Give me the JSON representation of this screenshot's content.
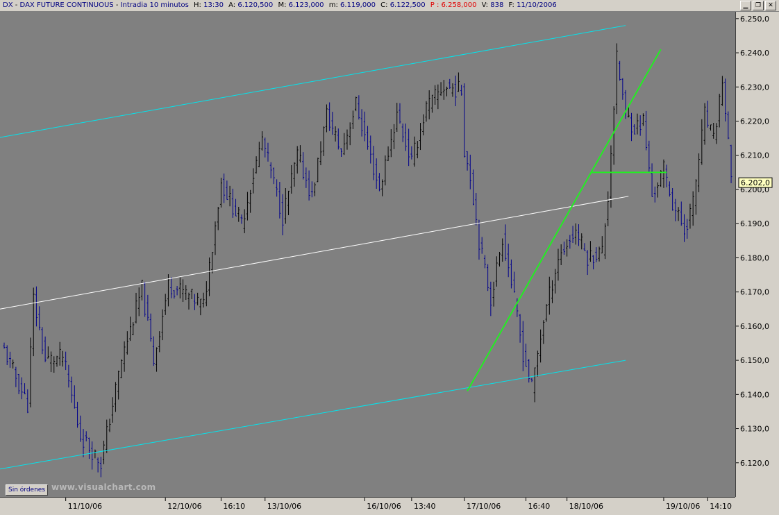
{
  "header": {
    "symbol": "DX",
    "instrument": "DAX FUTURE CONTINUOUS",
    "timeframe": "Intradia 10 minutos",
    "hour_label": "H:",
    "hour": "13:30",
    "open_label": "A:",
    "open": "6.120,500",
    "high_label": "M:",
    "high": "6.123,000",
    "low_label": "m:",
    "low": "6.119,000",
    "close_label": "C:",
    "close": "6.122,500",
    "price_label": "P :",
    "price": "6.258,000",
    "volume_label": "V:",
    "volume": "838",
    "date_label": "F:",
    "date": "11/10/2006"
  },
  "window_buttons": [
    {
      "name": "minimize",
      "glyph": "▁"
    },
    {
      "name": "restore",
      "glyph": "❐"
    },
    {
      "name": "close",
      "glyph": "✕"
    }
  ],
  "orders_button": "Sin órdenes",
  "watermark": "www.visualchart.com",
  "colors": {
    "plot_bg": "#808080",
    "up_bar": "#000000",
    "down_bar": "#00008b",
    "channel": "#00e5ee",
    "midline": "#ffffff",
    "trendline": "#22ee22",
    "last_price_bg": "#ffffc0"
  },
  "chart_data": {
    "type": "ohlc",
    "ylim": [
      6110,
      6252
    ],
    "yticks": [
      6120,
      6130,
      6140,
      6150,
      6160,
      6170,
      6180,
      6190,
      6200,
      6210,
      6220,
      6230,
      6240,
      6250
    ],
    "ytick_labels": [
      "6.120,0",
      "6.130,0",
      "6.140,0",
      "6.150,0",
      "6.160,0",
      "6.170,0",
      "6.180,0",
      "6.190,0",
      "6.200,0",
      "6.210,0",
      "6.220,0",
      "6.230,0",
      "6.240,0",
      "6.250,0"
    ],
    "last_price": 6202,
    "last_price_label": "6.202,0",
    "bars_total": 248,
    "xticks": [
      {
        "bar": 21,
        "label": "11/10/06"
      },
      {
        "bar": 55,
        "label": "12/10/06"
      },
      {
        "bar": 74,
        "label": "16:10"
      },
      {
        "bar": 89,
        "label": "13/10/06"
      },
      {
        "bar": 123,
        "label": "16/10/06"
      },
      {
        "bar": 139,
        "label": "13:40"
      },
      {
        "bar": 157,
        "label": "17/10/06"
      },
      {
        "bar": 178,
        "label": "16:40"
      },
      {
        "bar": 192,
        "label": "18/10/06"
      },
      {
        "bar": 225,
        "label": "19/10/06"
      },
      {
        "bar": 240,
        "label": "14:10"
      }
    ],
    "anchors": [
      [
        0,
        6153
      ],
      [
        8,
        6137
      ],
      [
        10,
        6168
      ],
      [
        14,
        6150
      ],
      [
        20,
        6151
      ],
      [
        26,
        6128
      ],
      [
        33,
        6120
      ],
      [
        40,
        6150
      ],
      [
        47,
        6171
      ],
      [
        51,
        6150
      ],
      [
        56,
        6172
      ],
      [
        61,
        6170
      ],
      [
        68,
        6166
      ],
      [
        74,
        6202
      ],
      [
        81,
        6190
      ],
      [
        88,
        6215
      ],
      [
        95,
        6192
      ],
      [
        100,
        6210
      ],
      [
        105,
        6198
      ],
      [
        110,
        6222
      ],
      [
        115,
        6211
      ],
      [
        120,
        6225
      ],
      [
        128,
        6200
      ],
      [
        134,
        6222
      ],
      [
        139,
        6208
      ],
      [
        144,
        6224
      ],
      [
        150,
        6230
      ],
      [
        156,
        6229
      ],
      [
        157,
        6212
      ],
      [
        159,
        6204
      ],
      [
        162,
        6185
      ],
      [
        166,
        6168
      ],
      [
        170,
        6186
      ],
      [
        173,
        6173
      ],
      [
        177,
        6152
      ],
      [
        180,
        6142
      ],
      [
        184,
        6162
      ],
      [
        189,
        6180
      ],
      [
        195,
        6188
      ],
      [
        199,
        6180
      ],
      [
        204,
        6182
      ],
      [
        206,
        6198
      ],
      [
        209,
        6238
      ],
      [
        212,
        6222
      ],
      [
        215,
        6218
      ],
      [
        218,
        6220
      ],
      [
        221,
        6198
      ],
      [
        225,
        6206
      ],
      [
        228,
        6196
      ],
      [
        232,
        6188
      ],
      [
        235,
        6196
      ],
      [
        239,
        6222
      ],
      [
        242,
        6214
      ],
      [
        245,
        6232
      ],
      [
        248,
        6203
      ]
    ],
    "lines": [
      {
        "name": "channel-upper",
        "role": "channel",
        "from": [
          -16,
          6213
        ],
        "to": [
          212,
          6248
        ]
      },
      {
        "name": "channel-lower",
        "role": "channel",
        "from": [
          -16,
          6116
        ],
        "to": [
          212,
          6150
        ]
      },
      {
        "name": "channel-mid",
        "role": "midline",
        "from": [
          -8,
          6164
        ],
        "to": [
          213,
          6198
        ]
      },
      {
        "name": "trend-support",
        "role": "trendline",
        "from": [
          158,
          6141
        ],
        "to": [
          224,
          6241
        ]
      },
      {
        "name": "trend-level",
        "role": "trendline",
        "from": [
          200,
          6205
        ],
        "to": [
          226,
          6205
        ]
      }
    ]
  }
}
